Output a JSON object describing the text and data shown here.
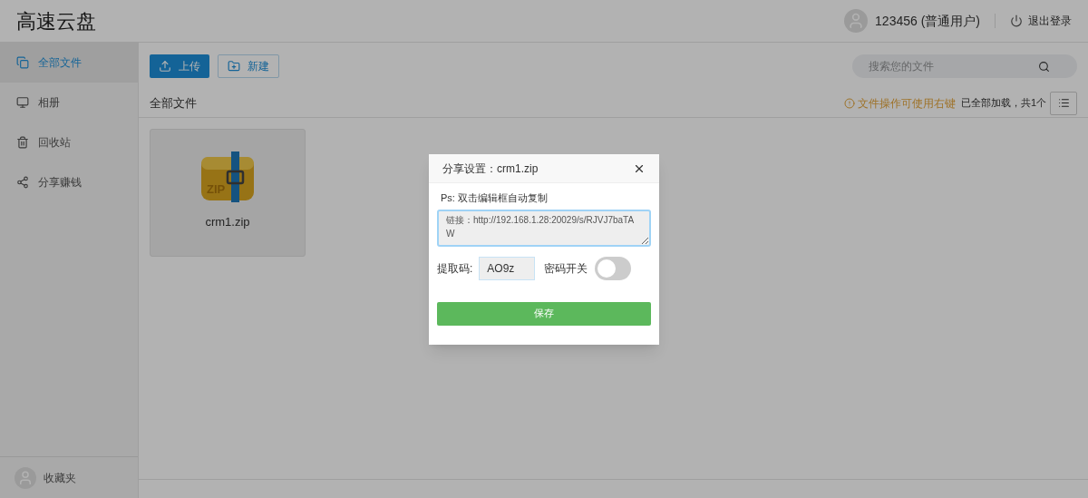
{
  "header": {
    "title": "高速云盘",
    "user": "123456 (普通用户)",
    "logout": "退出登录"
  },
  "sidebar": {
    "items": [
      {
        "label": "全部文件",
        "selected": true
      },
      {
        "label": "相册",
        "selected": false
      },
      {
        "label": "回收站",
        "selected": false
      },
      {
        "label": "分享赚钱",
        "selected": false
      }
    ],
    "footer": "收藏夹"
  },
  "toolbar": {
    "upload": "上传",
    "new": "新建",
    "search": {
      "placeholder": "搜索您的文件"
    }
  },
  "breadcrumb": "全部文件",
  "hint": "文件操作可使用右键",
  "status": "已全部加载，共1个",
  "files": [
    {
      "name": "crm1.zip",
      "icon_label": "ZIP",
      "selected": true
    }
  ],
  "dialog": {
    "title": "分享设置：crm1.zip",
    "note": "Ps: 双击编辑框自动复制",
    "link": "链接：http://192.168.1.28:20029/s/RJVJ7baTAW",
    "code_label": "提取码:",
    "code": "AO9z",
    "switch_label": "密码开关",
    "switch_on": false,
    "save": "保存"
  }
}
